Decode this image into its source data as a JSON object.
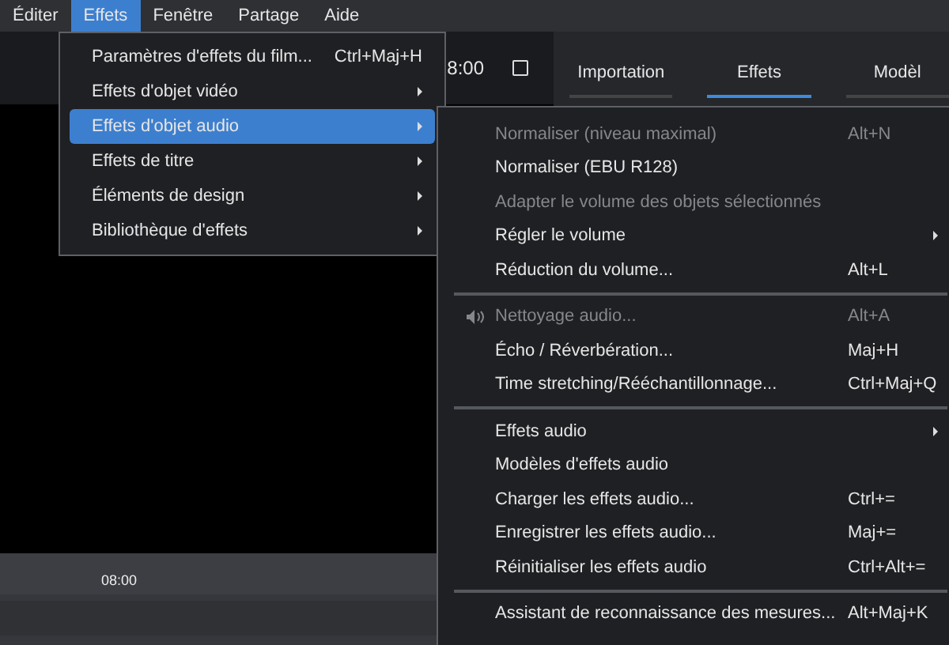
{
  "menubar": [
    {
      "label": "Éditer",
      "selected": false
    },
    {
      "label": "Effets",
      "selected": true
    },
    {
      "label": "Fenêtre",
      "selected": false
    },
    {
      "label": "Partage",
      "selected": false
    },
    {
      "label": "Aide",
      "selected": false
    }
  ],
  "preview": {
    "time": "8:00"
  },
  "panel_tabs": [
    {
      "label": "Importation",
      "selected": false
    },
    {
      "label": "Effets",
      "selected": true
    },
    {
      "label": "Modèl",
      "selected": false
    }
  ],
  "timeline": {
    "ruler_label": "08:00"
  },
  "effects_menu": [
    {
      "label": "Paramètres d'effets du film...",
      "shortcut": "Ctrl+Maj+H",
      "submenu": false,
      "selected": false
    },
    {
      "label": "Effets d'objet vidéo",
      "submenu": true,
      "selected": false
    },
    {
      "label": "Effets d'objet audio",
      "submenu": true,
      "selected": true
    },
    {
      "label": "Effets de titre",
      "submenu": true,
      "selected": false
    },
    {
      "label": "Éléments de design",
      "submenu": true,
      "selected": false
    },
    {
      "label": "Bibliothèque d'effets",
      "submenu": true,
      "selected": false
    }
  ],
  "audio_submenu": [
    [
      {
        "label": "Normaliser (niveau maximal)",
        "shortcut": "Alt+N",
        "disabled": true,
        "submenu": false
      },
      {
        "label": "Normaliser (EBU R128)",
        "disabled": false,
        "submenu": false
      },
      {
        "label": "Adapter le volume des objets sélectionnés",
        "disabled": true,
        "submenu": false
      },
      {
        "label": "Régler le volume",
        "disabled": false,
        "submenu": true
      },
      {
        "label": "Réduction du volume...",
        "shortcut": "Alt+L",
        "disabled": false,
        "submenu": false
      }
    ],
    [
      {
        "label": "Nettoyage audio...",
        "shortcut": "Alt+A",
        "disabled": true,
        "submenu": false,
        "speaker_icon": true
      },
      {
        "label": "Écho / Réverbération...",
        "shortcut": "Maj+H",
        "disabled": false,
        "submenu": false
      },
      {
        "label": "Time stretching/Rééchantillonnage...",
        "shortcut": "Ctrl+Maj+Q",
        "disabled": false,
        "submenu": false
      }
    ],
    [
      {
        "label": "Effets audio",
        "disabled": false,
        "submenu": true
      },
      {
        "label": "Modèles d'effets audio",
        "disabled": false,
        "submenu": false
      },
      {
        "label": "Charger les effets audio...",
        "shortcut": "Ctrl+=",
        "disabled": false,
        "submenu": false
      },
      {
        "label": "Enregistrer les effets audio...",
        "shortcut": "Maj+=",
        "disabled": false,
        "submenu": false
      },
      {
        "label": "Réinitialiser les effets audio",
        "shortcut": "Ctrl+Alt+=",
        "disabled": false,
        "submenu": false
      }
    ],
    [
      {
        "label": "Assistant de reconnaissance des mesures...",
        "shortcut": "Alt+Maj+K",
        "disabled": false,
        "submenu": false
      }
    ]
  ]
}
